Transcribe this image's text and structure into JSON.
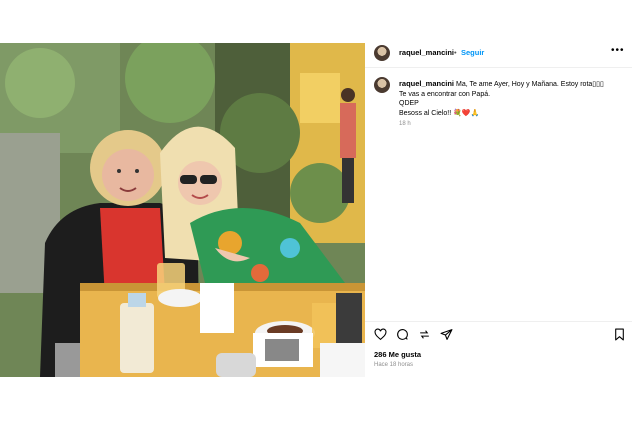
{
  "post": {
    "username": "raquel_mancini",
    "separator": "•",
    "follow_label": "Seguir",
    "more_icon": "more-options-icon",
    "caption_lines": [
      "Ma, Te ame Ayer, Hoy y Mañana. Estoy rota▯▯▯",
      "Te vas a encontrar con Papá.",
      "QDEP",
      "Besoss al Cielo!! 💐❤️🙏"
    ],
    "comment_time": "18 h",
    "likes": "286 Me gusta",
    "posted_ago": "Hace 18 horas",
    "icons": [
      "heart-icon",
      "comment-icon",
      "share-icon",
      "send-icon",
      "bookmark-icon"
    ]
  }
}
